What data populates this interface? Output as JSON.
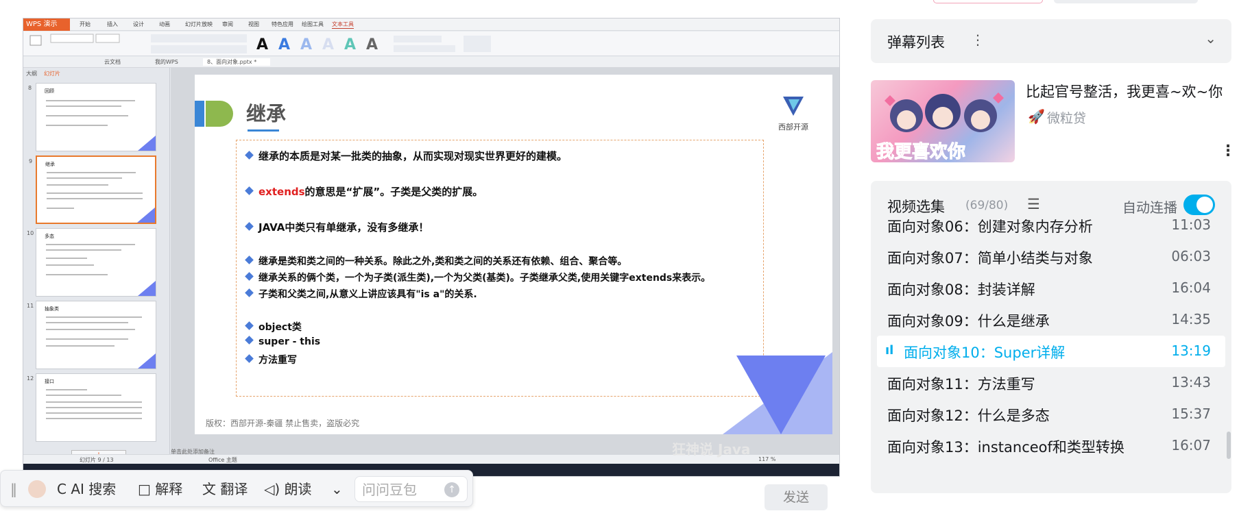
{
  "wps": {
    "app_name": "WPS 演示",
    "menu_tabs": [
      "开始",
      "插入",
      "设计",
      "动画",
      "幻灯片放映",
      "审阅",
      "视图",
      "特色应用",
      "绘图工具",
      "文本工具"
    ],
    "doc_tabs": [
      "云文档",
      "我的WPS",
      "8、面向对象.pptx *"
    ],
    "panel_tabs": [
      "大纲",
      "幻灯片"
    ],
    "status_left": "幻灯片 9 / 13",
    "status_theme": "Office 主题",
    "zoom": "117 %",
    "note_hint": "单击此处添加备注",
    "thumb_numbers": [
      "8",
      "9",
      "10",
      "11",
      "12"
    ],
    "thumb_titles": [
      "回顾",
      "继承",
      "多态",
      "抽象类",
      "接口"
    ]
  },
  "slide": {
    "title": "继承",
    "logo_text": "西部开源",
    "bullets_group1": [
      "继承的本质是对某一批类的抽象，从而实现对现实世界更好的建模。"
    ],
    "bullet_extends_red": "extends",
    "bullet_extends_rest": "的意思是“扩展”。子类是父类的扩展。",
    "bullet_java": "JAVA中类只有单继承，没有多继承！",
    "bullets_group2": [
      "继承是类和类之间的一种关系。除此之外,类和类之间的关系还有依赖、组合、聚合等。",
      "继承关系的俩个类，一个为子类(派生类),一个为父类(基类)。子类继承父类,使用关键字extends来表示。",
      "子类和父类之间,从意义上讲应该具有\"is a\"的关系."
    ],
    "bullets_group3": [
      "object类",
      "super -  this",
      "方法重写"
    ],
    "footer": "版权：西部开源-秦疆    禁止售卖，盗版必究",
    "watermark": "狂神说 Java"
  },
  "float_toolbar": {
    "ai_search": "AI 搜索",
    "explain": "解释",
    "translate": "翻译",
    "read": "朗读",
    "input_placeholder": "问问豆包"
  },
  "send_button": "发送",
  "danmu": {
    "title": "弹幕列表"
  },
  "ad": {
    "title": "比起官号整活，我更喜~欢~你",
    "source": "微粒贷",
    "image_text": "我更喜欢你"
  },
  "playlist": {
    "title": "视频选集",
    "count": "(69/80)",
    "autoplay_label": "自动连播",
    "autoplay_on": true,
    "episodes": [
      {
        "title": "面向对象06：创建对象内存分析",
        "duration": "11:03"
      },
      {
        "title": "面向对象07：简单小结类与对象",
        "duration": "06:03"
      },
      {
        "title": "面向对象08：封装详解",
        "duration": "16:04"
      },
      {
        "title": "面向对象09：什么是继承",
        "duration": "14:35"
      },
      {
        "title": "面向对象10：Super详解",
        "duration": "13:19"
      },
      {
        "title": "面向对象11：方法重写",
        "duration": "13:43"
      },
      {
        "title": "面向对象12：什么是多态",
        "duration": "15:37"
      },
      {
        "title": "面向对象13：instanceof和类型转换",
        "duration": "16:07"
      }
    ]
  },
  "colors": {
    "accent": "#00aeec",
    "wps_brand": "#e8622c",
    "slide_blue": "#3a86d6",
    "slide_green": "#8eb84e",
    "bullet_red": "#e02020"
  }
}
